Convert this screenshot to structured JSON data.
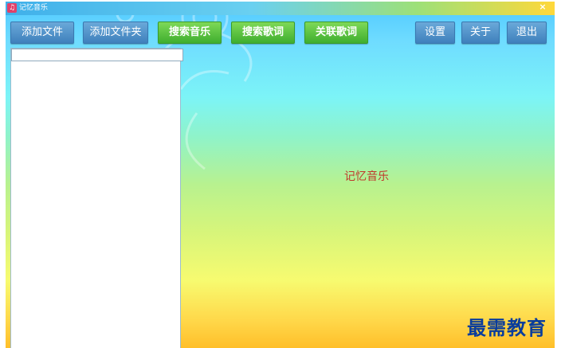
{
  "window": {
    "title": "记忆音乐",
    "close_glyph": "×"
  },
  "toolbar": {
    "add_file": "添加文件",
    "add_folder": "添加文件夹",
    "search_music": "搜索音乐",
    "search_lyrics": "搜索歌词",
    "link_lyrics": "关联歌词",
    "settings": "设置",
    "about": "关于",
    "exit": "退出"
  },
  "playlist": {
    "search_value": ""
  },
  "main": {
    "center_text": "记忆音乐"
  },
  "watermark": "最需教育",
  "colors": {
    "blue_button": "#4a8ac6",
    "green_button": "#4cbf38",
    "center_text": "#c0392b",
    "watermark": "#0a3d9c"
  },
  "icons": {
    "app": "music-note-icon",
    "close": "close-icon"
  }
}
